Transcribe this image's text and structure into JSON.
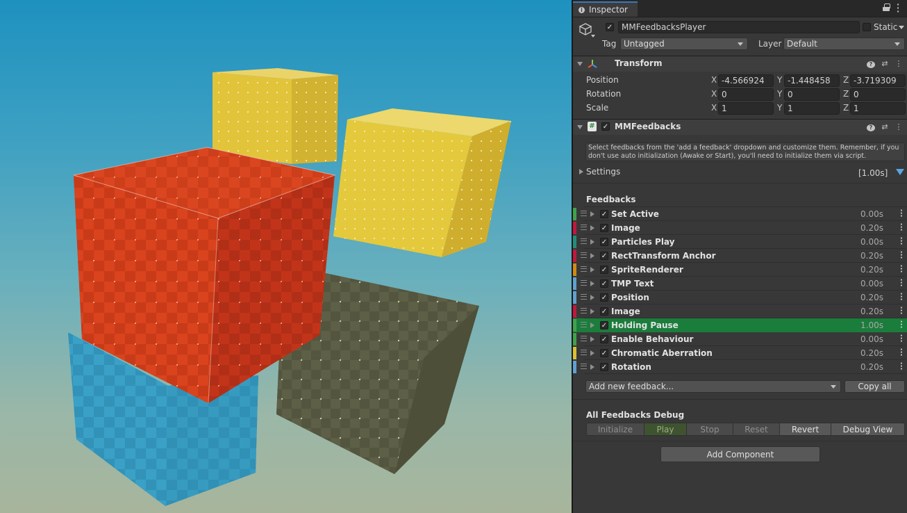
{
  "inspector": {
    "tab_label": "Inspector",
    "object": {
      "name": "MMFeedbacksPlayer",
      "active": true,
      "static_label": "Static",
      "static": false,
      "tag_label": "Tag",
      "tag_value": "Untagged",
      "layer_label": "Layer",
      "layer_value": "Default"
    },
    "transform": {
      "title": "Transform",
      "rows": [
        {
          "label": "Position",
          "x": "-4.566924",
          "y": "-1.448458",
          "z": "-3.719309"
        },
        {
          "label": "Rotation",
          "x": "0",
          "y": "0",
          "z": "0"
        },
        {
          "label": "Scale",
          "x": "1",
          "y": "1",
          "z": "1"
        }
      ]
    },
    "mmfeedbacks": {
      "title": "MMFeedbacks",
      "enabled": true,
      "help_text": "Select feedbacks from the 'add a feedback' dropdown and customize them. Remember, if you don't use auto initialization (Awake or Start), you'll need to initialize them via script.",
      "settings_label": "Settings",
      "settings_duration": "[1.00s]",
      "feedbacks_label": "Feedbacks",
      "feedbacks": [
        {
          "name": "Set Active",
          "time": "0.00s",
          "color": "#3fa34a"
        },
        {
          "name": "Image",
          "time": "0.20s",
          "color": "#c2173f"
        },
        {
          "name": "Particles Play",
          "time": "0.00s",
          "color": "#1f8f7a"
        },
        {
          "name": "RectTransform Anchor",
          "time": "0.20s",
          "color": "#c2173f"
        },
        {
          "name": "SpriteRenderer",
          "time": "0.20s",
          "color": "#d08a12"
        },
        {
          "name": "TMP Text",
          "time": "0.00s",
          "color": "#5fa1d0"
        },
        {
          "name": "Position",
          "time": "0.20s",
          "color": "#5fa1d0"
        },
        {
          "name": "Image",
          "time": "0.20s",
          "color": "#c2173f"
        },
        {
          "name": "Holding Pause",
          "time": "1.00s",
          "color": "#3fa34a",
          "highlight": true
        },
        {
          "name": "Enable Behaviour",
          "time": "0.00s",
          "color": "#3fa34a"
        },
        {
          "name": "Chromatic Aberration",
          "time": "0.20s",
          "color": "#d8c230"
        },
        {
          "name": "Rotation",
          "time": "0.20s",
          "color": "#5fa1d0"
        }
      ],
      "add_feedback_label": "Add new feedback...",
      "copy_all_label": "Copy all",
      "debug_title": "All Feedbacks Debug",
      "debug_buttons": [
        "Initialize",
        "Play",
        "Stop",
        "Reset",
        "Revert",
        "Debug View"
      ]
    },
    "add_component_label": "Add Component"
  }
}
